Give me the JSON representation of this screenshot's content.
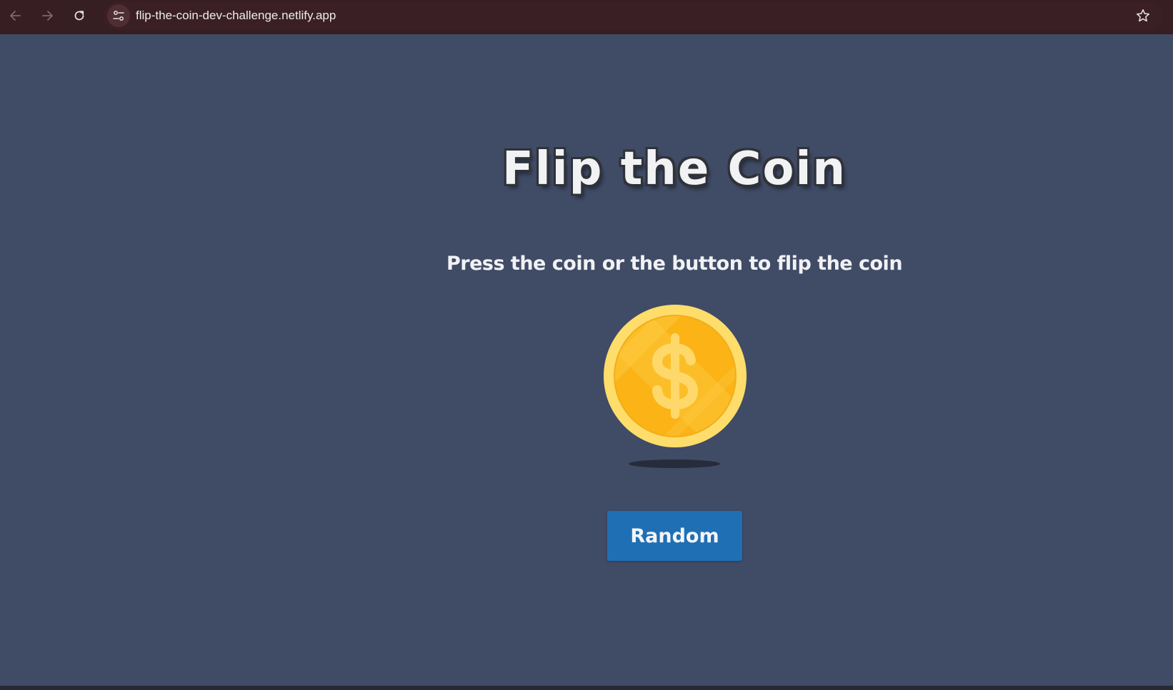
{
  "browser": {
    "url": "flip-the-coin-dev-challenge.netlify.app",
    "back_icon": "arrow-left-icon",
    "forward_icon": "arrow-right-icon",
    "reload_icon": "reload-icon",
    "site_info_icon": "tune-icon",
    "bookmark_icon": "star-icon"
  },
  "page": {
    "title": "Flip the Coin",
    "subtitle": "Press the coin or the button to flip the coin",
    "coin_icon": "dollar-coin-icon",
    "button_label": "Random"
  },
  "colors": {
    "browser_bar": "#361e23",
    "page_background": "#404b66",
    "button": "#1f6fb5",
    "coin_gold": "#fbb316",
    "coin_rim": "#fedd6b"
  }
}
